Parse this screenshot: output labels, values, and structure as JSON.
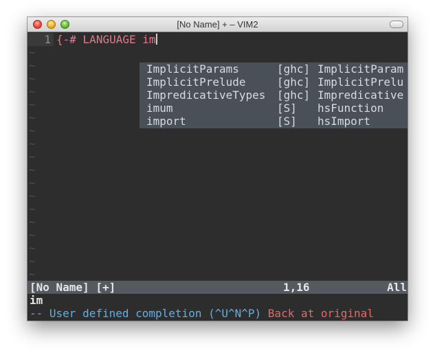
{
  "window": {
    "title": "[No Name] + – VIM2"
  },
  "editor": {
    "line_number": "1",
    "pragma_open": "{-#",
    "keyword": "LANGUAGE",
    "typed": "im",
    "empty_line_marker": "~"
  },
  "completion_popup": {
    "items": [
      {
        "word": "ImplicitParams",
        "kind": "[ghc]",
        "menu": "ImplicitParam"
      },
      {
        "word": "ImplicitPrelude",
        "kind": "[ghc]",
        "menu": "ImplicitPrelu"
      },
      {
        "word": "ImpredicativeTypes",
        "kind": "[ghc]",
        "menu": "Impredicative"
      },
      {
        "word": "imum",
        "kind": "[S]",
        "menu": "hsFunction"
      },
      {
        "word": "import",
        "kind": "[S]",
        "menu": "hsImport"
      }
    ]
  },
  "statusline": {
    "file": "[No Name] [+]",
    "position": "1,16",
    "scroll": "All"
  },
  "cmdline": {
    "typed": "im",
    "mode_message": "-- User defined completion (^U^N^P)",
    "status_message": "Back at original"
  },
  "colors": {
    "background": "#2d2d2d",
    "pragma": "#e07b8b",
    "popup_bg": "#4a5057",
    "statusline_bg": "#555a61",
    "mode_message": "#5fb0e6",
    "status_message": "#e06a6a"
  }
}
